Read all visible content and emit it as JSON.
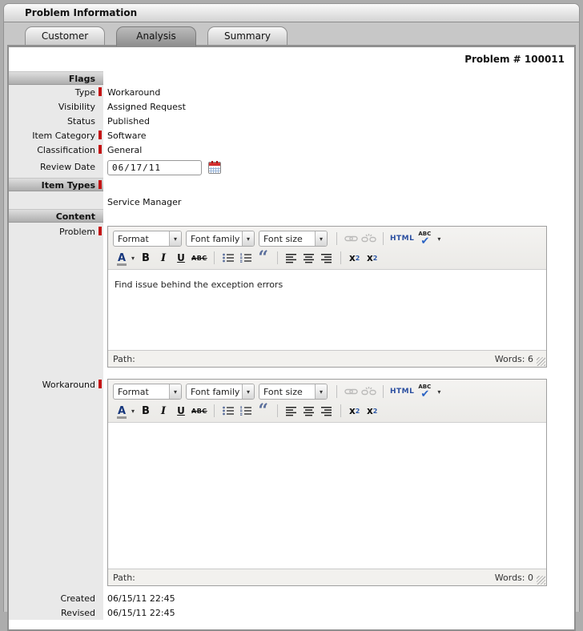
{
  "window": {
    "title": "Problem Information"
  },
  "tabs": [
    {
      "label": "Customer"
    },
    {
      "label": "Analysis"
    },
    {
      "label": "Summary"
    }
  ],
  "header": {
    "problem_number": "Problem # 100011"
  },
  "form": {
    "flags_header": "Flags",
    "type": {
      "label": "Type",
      "value": "Workaround"
    },
    "visibility": {
      "label": "Visibility",
      "value": "Assigned Request"
    },
    "status": {
      "label": "Status",
      "value": "Published"
    },
    "item_category": {
      "label": "Item Category",
      "value": "Software"
    },
    "classification": {
      "label": "Classification",
      "value": "General"
    },
    "review_date": {
      "label": "Review Date",
      "value": "06/17/11"
    },
    "item_types_header": "Item Types",
    "item_types_value": "Service Manager",
    "content_header": "Content",
    "problem_label": "Problem",
    "workaround_label": "Workaround",
    "created": {
      "label": "Created",
      "value": "06/15/11 22:45"
    },
    "revised": {
      "label": "Revised",
      "value": "06/15/11 22:45"
    }
  },
  "editor": {
    "format_label": "Format",
    "font_family_label": "Font family",
    "font_size_label": "Font size",
    "html_label": "HTML",
    "spell_label": "ABC",
    "path_label": "Path:",
    "forecolor": "A",
    "bold": "B",
    "italic": "I",
    "underline": "U",
    "strike": "ABC",
    "quote": "“",
    "sub_base": "x",
    "sub_script": "2",
    "sup_base": "x",
    "sup_script": "2"
  },
  "problem_editor": {
    "text": "Find issue behind the exception errors",
    "words": "Words: 6"
  },
  "workaround_editor": {
    "text": "",
    "words": "Words: 0"
  },
  "colors": {
    "required_marker": "#c41414",
    "accent_blue": "#2b4fa0"
  }
}
